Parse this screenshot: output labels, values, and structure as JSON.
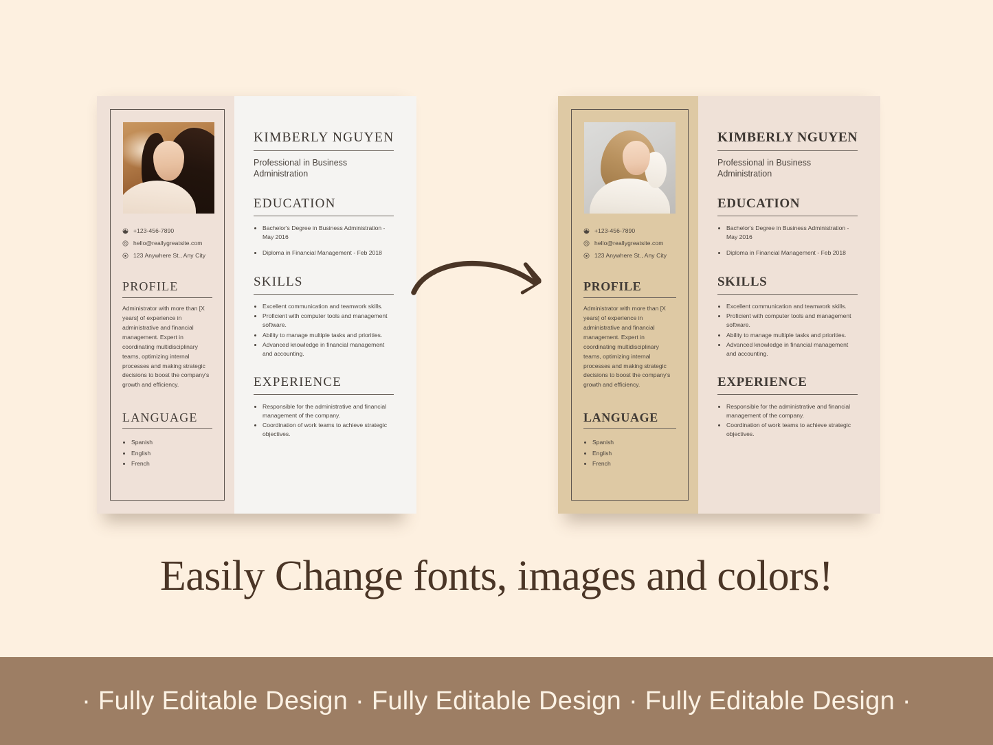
{
  "page": {
    "background_color": "#FDF0E0",
    "headline": "Easily Change fonts, images and colors!",
    "banner": {
      "text": "· Fully Editable Design · Fully Editable Design · Fully Editable Design ·",
      "background_color": "#9D7E64",
      "text_color": "#FCF2E4"
    },
    "arrow": {
      "icon": "curved-arrow-right-icon",
      "color": "#4A3526"
    }
  },
  "resume_content": {
    "name": "KIMBERLY NGUYEN",
    "role": "Professional in Business Administration",
    "contact": [
      {
        "icon": "phone-icon",
        "value": "+123-456-7890"
      },
      {
        "icon": "email-at-icon",
        "value": "hello@reallygreatsite.com"
      },
      {
        "icon": "location-pin-icon",
        "value": "123 Anywhere St., Any City"
      }
    ],
    "profile": {
      "heading": "PROFILE",
      "text": "Administrator with more than [X years] of experience in administrative and financial management. Expert in coordinating multidisciplinary teams, optimizing internal processes and making strategic decisions to boost the company's growth and efficiency."
    },
    "language": {
      "heading": "LANGUAGE",
      "items": [
        "Spanish",
        "English",
        "French"
      ]
    },
    "education": {
      "heading": "EDUCATION",
      "items": [
        "Bachelor's Degree in Business Administration - May 2016",
        "Diploma in Financial Management - Feb 2018"
      ]
    },
    "skills": {
      "heading": "SKILLS",
      "items": [
        "Excellent communication and teamwork skills.",
        "Proficient with computer tools and management software.",
        "Ability to manage multiple tasks and priorities.",
        "Advanced knowledge in financial management and accounting."
      ]
    },
    "experience": {
      "heading": "EXPERIENCE",
      "items": [
        "Responsible for the administrative and financial management of the company.",
        "Coordination of work teams to achieve strategic objectives."
      ]
    }
  },
  "variants": [
    {
      "id": "left",
      "sidebar_color": "#EFE1D8",
      "main_color": "#F5F4F2",
      "photo": "portrait-dark-hair-autumn"
    },
    {
      "id": "right",
      "sidebar_color": "#DEC9A4",
      "main_color": "#EFE1D7",
      "photo": "portrait-blonde-white-sweater"
    }
  ]
}
